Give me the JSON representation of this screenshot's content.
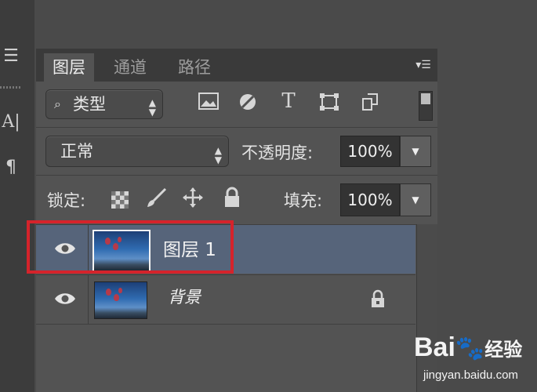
{
  "panel": {
    "tabs": [
      {
        "label": "图层",
        "active": true
      },
      {
        "label": "通道",
        "active": false
      },
      {
        "label": "路径",
        "active": false
      }
    ],
    "menu_icon": "panel-menu-icon"
  },
  "filter": {
    "kind_label": "类型",
    "icons": [
      "image-filter-icon",
      "adjustment-filter-icon",
      "type-filter-icon",
      "shape-filter-icon",
      "smart-object-filter-icon"
    ],
    "type_glyph": "T"
  },
  "blend": {
    "mode": "正常",
    "opacity_label": "不透明度:",
    "opacity_value": "100%"
  },
  "lock": {
    "label": "锁定:",
    "icons": [
      "lock-transparent-icon",
      "lock-paint-icon",
      "lock-position-icon",
      "lock-all-icon"
    ],
    "fill_label": "填充:",
    "fill_value": "100%"
  },
  "layers": [
    {
      "name": "图层 1",
      "selected": true,
      "locked": false,
      "visible": true
    },
    {
      "name": "背景",
      "selected": false,
      "locked": true,
      "visible": true
    }
  ],
  "colors": {
    "selection": "#56647a",
    "highlight_box": "#d5232b",
    "panel_bg": "#535353"
  },
  "watermark": {
    "brand": "Bai",
    "brand2": "经验",
    "url": "jingyan.baidu.com"
  }
}
